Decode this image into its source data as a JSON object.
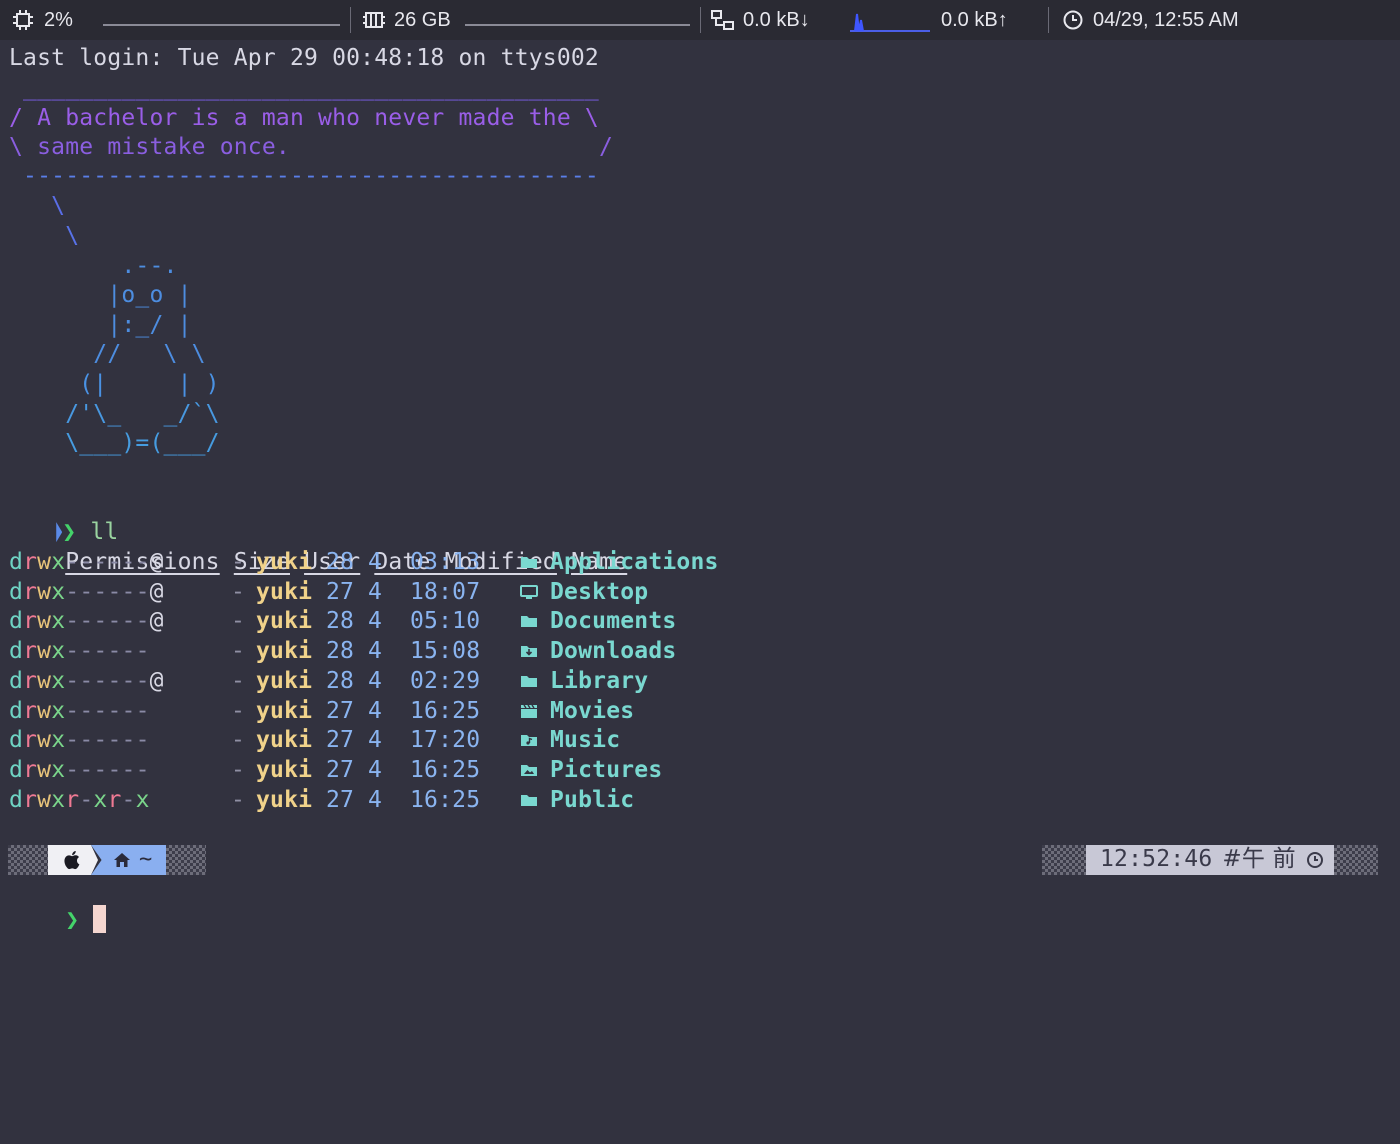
{
  "menubar": {
    "cpu": {
      "icon": "cpu-icon",
      "value": "2%"
    },
    "memory": {
      "icon": "memory-icon",
      "value": "26 GB"
    },
    "network": {
      "icon": "network-icon",
      "down": "0.0 kB↓",
      "up": "0.0 kB↑"
    },
    "clock": {
      "icon": "clock-icon",
      "value": "04/29, 12:55 AM"
    }
  },
  "terminal": {
    "last_login": "Last login: Tue Apr 29 00:48:18 on ttys002",
    "cowsay": {
      "top_border": " _________________________________________",
      "line1": "/ A bachelor is a man who never made the \\",
      "line2": "\\ same mistake once.                      /",
      "bottom_border": " -----------------------------------------",
      "art": [
        "   \\",
        "    \\",
        "        .--.",
        "       |o_o |",
        "       |:_/ |",
        "      //   \\ \\",
        "     (|     | )",
        "    /'\\_   _/`\\",
        "    \\___)=(___/"
      ]
    },
    "prompt_symbol": "❯",
    "command": "ll",
    "listing": {
      "headers": [
        "Permissions",
        "Size",
        "User",
        "Date Modified",
        "Name"
      ],
      "rows": [
        {
          "perm": "drwx------@",
          "size": "-",
          "user": "yuki",
          "day": "28",
          "month": "4",
          "time": "03:13",
          "icon": "folder-icon",
          "name": "Applications"
        },
        {
          "perm": "drwx------@",
          "size": "-",
          "user": "yuki",
          "day": "27",
          "month": "4",
          "time": "18:07",
          "icon": "desktop-icon",
          "name": "Desktop"
        },
        {
          "perm": "drwx------@",
          "size": "-",
          "user": "yuki",
          "day": "28",
          "month": "4",
          "time": "05:10",
          "icon": "folder-icon",
          "name": "Documents"
        },
        {
          "perm": "drwx------",
          "size": "-",
          "user": "yuki",
          "day": "28",
          "month": "4",
          "time": "15:08",
          "icon": "folder-download-icon",
          "name": "Downloads"
        },
        {
          "perm": "drwx------@",
          "size": "-",
          "user": "yuki",
          "day": "28",
          "month": "4",
          "time": "02:29",
          "icon": "folder-icon",
          "name": "Library"
        },
        {
          "perm": "drwx------",
          "size": "-",
          "user": "yuki",
          "day": "27",
          "month": "4",
          "time": "16:25",
          "icon": "clapperboard-icon",
          "name": "Movies"
        },
        {
          "perm": "drwx------",
          "size": "-",
          "user": "yuki",
          "day": "27",
          "month": "4",
          "time": "17:20",
          "icon": "folder-music-icon",
          "name": "Music"
        },
        {
          "perm": "drwx------",
          "size": "-",
          "user": "yuki",
          "day": "27",
          "month": "4",
          "time": "16:25",
          "icon": "folder-image-icon",
          "name": "Pictures"
        },
        {
          "perm": "drwxr-xr-x",
          "size": "-",
          "user": "yuki",
          "day": "27",
          "month": "4",
          "time": "16:25",
          "icon": "folder-icon",
          "name": "Public"
        }
      ]
    },
    "statusline": {
      "left": {
        "os_icon": "apple-icon",
        "home_icon": "home-icon",
        "path": "~"
      },
      "right": {
        "time": "12:52:46",
        "ampm": "#午 前",
        "clock_icon": "clock-icon"
      }
    }
  },
  "colors": {
    "background": "#32323f",
    "menubar": "#2a2a33",
    "quote": "#a45ce0",
    "penguin": "#4d8de0",
    "filename": "#7ad8d0",
    "user": "#f0d28a",
    "prompt_green": "#44d36a",
    "cursor": "#f5d6d0"
  }
}
